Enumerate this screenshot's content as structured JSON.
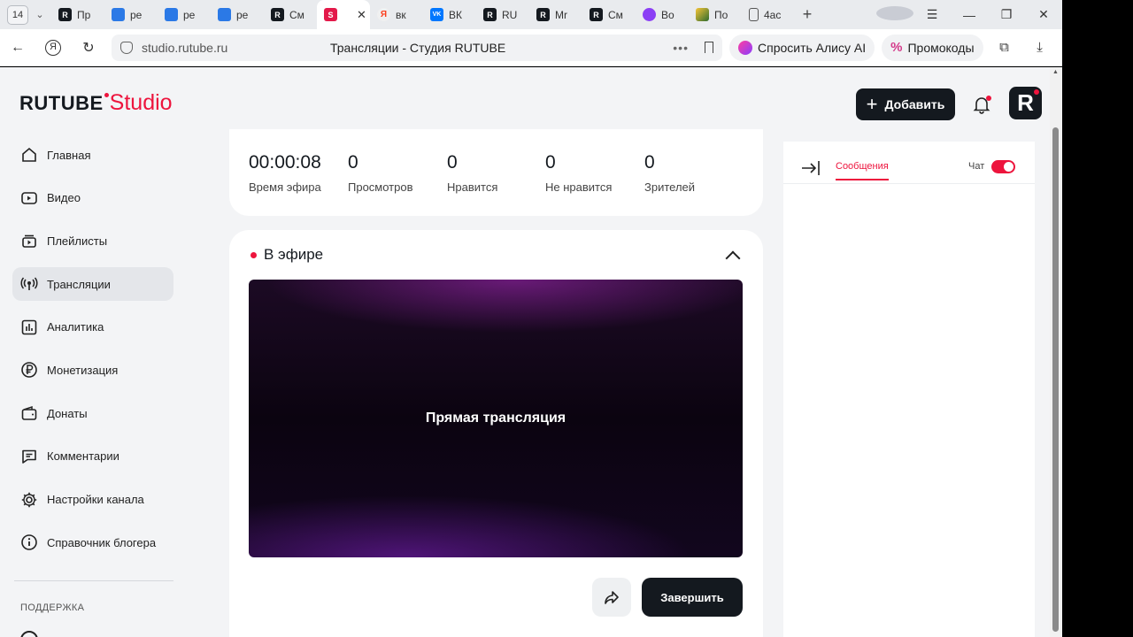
{
  "browser": {
    "tab_counter": "14",
    "tabs": [
      {
        "label": "Пр",
        "icon": "rutube-icon"
      },
      {
        "label": "ре",
        "icon": "doc-icon"
      },
      {
        "label": "ре",
        "icon": "doc-icon"
      },
      {
        "label": "ре",
        "icon": "doc-icon"
      },
      {
        "label": "См",
        "icon": "rutube-icon"
      },
      {
        "label": "",
        "icon": "studio-icon",
        "active": true
      },
      {
        "label": "вк",
        "icon": "yandex-icon"
      },
      {
        "label": "ВК",
        "icon": "vk-icon"
      },
      {
        "label": "RU",
        "icon": "rutube-icon"
      },
      {
        "label": "Mr",
        "icon": "rutube-icon"
      },
      {
        "label": "См",
        "icon": "rutube-icon"
      },
      {
        "label": "Во",
        "icon": "alice-icon"
      },
      {
        "label": "По",
        "icon": "picture-icon"
      },
      {
        "label": "4ас",
        "icon": "file-icon"
      }
    ],
    "url": "studio.rutube.ru",
    "page_title": "Трансляции - Студия RUTUBE",
    "ask_alice": "Спросить Алису AI",
    "promo": "Промокоды"
  },
  "header": {
    "logo_main": "RUTUBE",
    "logo_sub": "Studio",
    "add_button": "Добавить"
  },
  "sidebar": {
    "items": [
      {
        "label": "Главная",
        "icon": "home-icon"
      },
      {
        "label": "Видео",
        "icon": "video-icon"
      },
      {
        "label": "Плейлисты",
        "icon": "playlist-icon"
      },
      {
        "label": "Трансляции",
        "icon": "broadcast-icon",
        "active": true
      },
      {
        "label": "Аналитика",
        "icon": "analytics-icon"
      },
      {
        "label": "Монетизация",
        "icon": "ruble-icon"
      },
      {
        "label": "Донаты",
        "icon": "wallet-icon"
      },
      {
        "label": "Комментарии",
        "icon": "comment-icon"
      },
      {
        "label": "Настройки канала",
        "icon": "gear-icon"
      },
      {
        "label": "Справочник блогера",
        "icon": "info-icon"
      }
    ],
    "support_title": "ПОДДЕРЖКА"
  },
  "stats": [
    {
      "value": "00:00:08",
      "label": "Время эфира"
    },
    {
      "value": "0",
      "label": "Просмотров"
    },
    {
      "value": "0",
      "label": "Нравится"
    },
    {
      "value": "0",
      "label": "Не нравится"
    },
    {
      "value": "0",
      "label": "Зрителей"
    }
  ],
  "live": {
    "title": "В эфире",
    "player_text": "Прямая трансляция",
    "end_button": "Завершить"
  },
  "chat": {
    "tab_messages": "Сообщения",
    "toggle_label": "Чат",
    "toggle_on": true
  },
  "colors": {
    "accent": "#ed143d",
    "dark": "#14191f",
    "page_bg": "#f3f4f6"
  }
}
